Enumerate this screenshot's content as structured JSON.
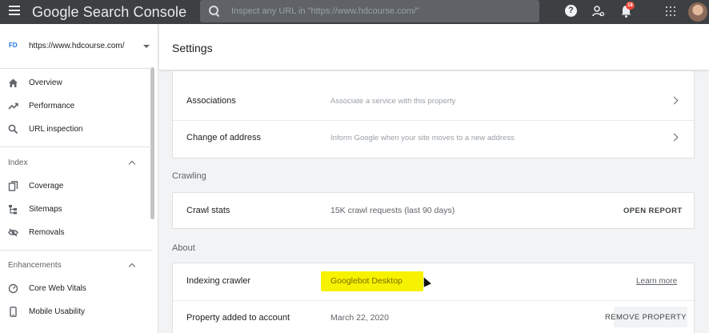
{
  "topbar": {
    "app_title": "Google Search Console",
    "search_placeholder": "Inspect any URL in \"https://www.hdcourse.com/\"",
    "help_icon": "?",
    "notification_count": "18"
  },
  "sidebar": {
    "property_url": "https://www.hdcourse.com/",
    "property_icon": "FD",
    "top_items": [
      {
        "label": "Overview",
        "icon": "home-icon"
      },
      {
        "label": "Performance",
        "icon": "trending-up-icon"
      },
      {
        "label": "URL inspection",
        "icon": "search-icon"
      }
    ],
    "index_header": "Index",
    "index_items": [
      {
        "label": "Coverage",
        "icon": "coverage-icon"
      },
      {
        "label": "Sitemaps",
        "icon": "sitemap-icon"
      },
      {
        "label": "Removals",
        "icon": "eye-off-icon"
      }
    ],
    "enhancements_header": "Enhancements",
    "enhancement_items": [
      {
        "label": "Core Web Vitals",
        "icon": "gauge-icon"
      },
      {
        "label": "Mobile Usability",
        "icon": "phone-icon"
      }
    ]
  },
  "main": {
    "page_title": "Settings",
    "general_rows": [
      {
        "label": "Associations",
        "description": "Associate a service with this property"
      },
      {
        "label": "Change of address",
        "description": "Inform Google when your site moves to a new address"
      }
    ],
    "crawling_section": "Crawling",
    "crawl_stats": {
      "label": "Crawl stats",
      "value": "15K crawl requests (last 90 days)",
      "action": "OPEN REPORT"
    },
    "about_section": "About",
    "indexing_crawler": {
      "label": "Indexing crawler",
      "value": "Googlebot Desktop",
      "action": "Learn more"
    },
    "property_added": {
      "label": "Property added to account",
      "value": "March 22, 2020",
      "action": "REMOVE PROPERTY"
    }
  },
  "colors": {
    "topbar": "#3c4043",
    "highlight": "#f7f200",
    "accent": "#1a73e8"
  }
}
